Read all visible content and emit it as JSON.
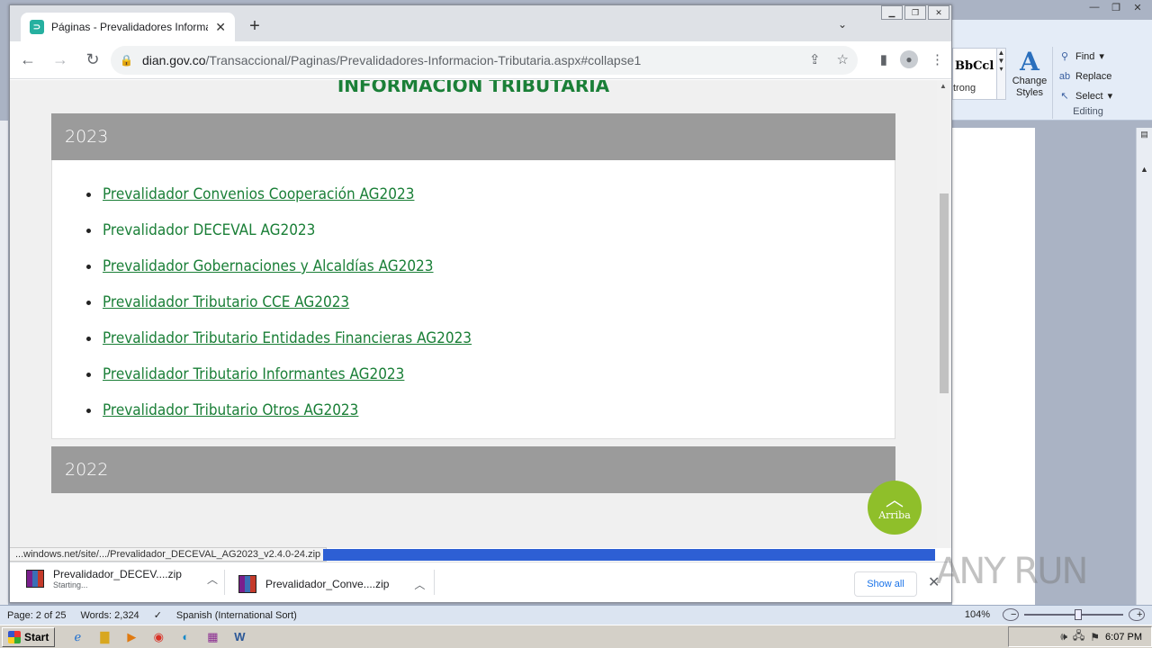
{
  "word": {
    "styles_sample": "BbCcl",
    "styles_strong": "trong",
    "change_styles": "Change Styles",
    "find": "Find",
    "replace": "Replace",
    "select": "Select",
    "editing": "Editing",
    "status": {
      "page": "Page: 2 of 25",
      "words": "Words: 2,324",
      "language": "Spanish (International Sort)",
      "zoom": "104%"
    }
  },
  "taskbar": {
    "start": "Start",
    "clock": "6:07 PM"
  },
  "chrome": {
    "tab_title": "Páginas - Prevalidadores Informacio",
    "url_host": "dian.gov.co",
    "url_path": "/Transaccional/Paginas/Prevalidadores-Informacion-Tributaria.aspx#collapse1"
  },
  "page": {
    "heading": "INFORMACION TRIBUTARIA",
    "panel_2023_title": "2023",
    "panel_2022_title": "2022",
    "items": [
      "Prevalidador Convenios Cooperación AG2023",
      "Prevalidador DECEVAL AG2023",
      "Prevalidador Gobernaciones y Alcaldías AG2023",
      "Prevalidador Tributario CCE AG2023",
      "Prevalidador Tributario Entidades Financieras AG2023",
      "Prevalidador Tributario Informantes AG2023",
      "Prevalidador Tributario Otros AG2023"
    ],
    "arriba": "Arriba"
  },
  "status_url": "...windows.net/site/.../Prevalidador_DECEVAL_AG2023_v2.4.0-24.zip",
  "downloads": {
    "item1_name": "Prevalidador_DECEV....zip",
    "item1_status": "Starting...",
    "item2_name": "Prevalidador_Conve....zip",
    "show_all": "Show all"
  },
  "watermark": "ANY RUN"
}
